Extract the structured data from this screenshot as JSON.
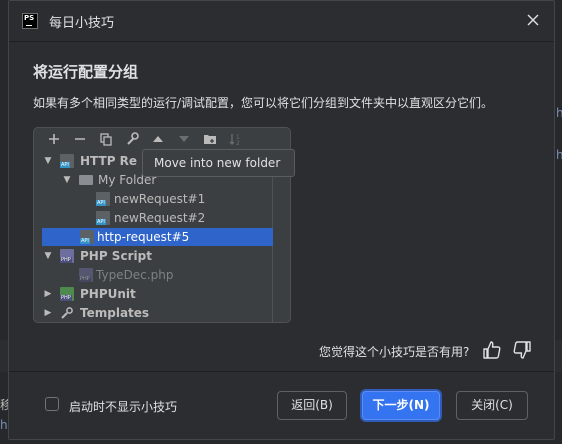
{
  "background": {
    "right_char_1": "h",
    "right_char_2": "h",
    "left_char_1": "移",
    "left_char_2": "h"
  },
  "dialog": {
    "app_icon_text": "PS",
    "title": "每日小技巧",
    "close_icon": "close-icon"
  },
  "tip": {
    "heading": "将运行配置分组",
    "description": "如果有多个相同类型的运行/调试配置，您可以将它们分组到文件夹中以直观区分它们。"
  },
  "preview": {
    "toolbar": [
      "+",
      "−",
      "⧉",
      "🔧",
      "▲",
      "▼",
      "📁",
      "↓²"
    ],
    "tooltip": "Move into new folder",
    "tree": [
      {
        "label": "HTTP Re",
        "bold": true,
        "arrow": "▼",
        "icon": "api"
      },
      {
        "label": "My Folder",
        "bold": false,
        "arrow": "▼",
        "icon": "folder"
      },
      {
        "label": "newRequest#1",
        "bold": false,
        "icon": "api"
      },
      {
        "label": "newRequest#2",
        "bold": false,
        "icon": "api"
      },
      {
        "label": "http-request#5",
        "bold": false,
        "icon": "api",
        "selected": true
      },
      {
        "label": "PHP Script",
        "bold": true,
        "arrow": "▼",
        "icon": "php"
      },
      {
        "label": "TypeDec.php",
        "bold": false,
        "icon": "php",
        "greyed": true
      },
      {
        "label": "PHPUnit",
        "bold": true,
        "arrow": "▶",
        "icon": "phpunit"
      },
      {
        "label": "Templates",
        "bold": true,
        "arrow": "▶",
        "icon": "wrench"
      }
    ]
  },
  "feedback": {
    "question": "您觉得这个小技巧是否有用?",
    "like_icon": "thumbs-up-icon",
    "dislike_icon": "thumbs-down-icon"
  },
  "footer": {
    "checkbox_label": "启动时不显示小技巧",
    "checkbox_checked": false,
    "back_label": "返回(B)",
    "next_label": "下一步(N)",
    "close_label": "关闭(C)"
  },
  "colors": {
    "accent": "#3574f0",
    "selection": "#2f65ca",
    "background": "#2b2d30"
  }
}
